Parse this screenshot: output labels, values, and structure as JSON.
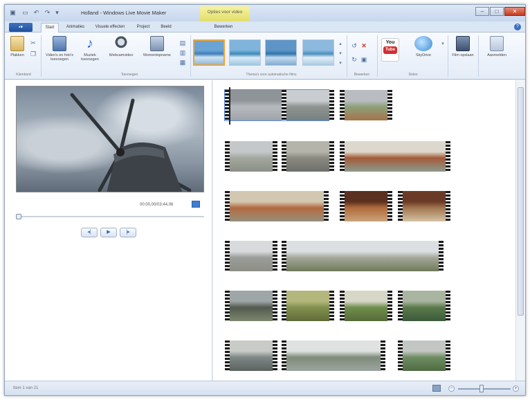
{
  "window": {
    "title": "Holland - Windows Live Movie Maker",
    "context_tab_title": "Opties voor video",
    "buttons": {
      "minimize": "–",
      "maximize": "□",
      "close": "✕"
    }
  },
  "qat": {
    "save_icon": "save-icon",
    "undo_icon": "undo-icon",
    "redo_icon": "redo-icon"
  },
  "app_menu": {
    "label": "▪▾"
  },
  "tabs": [
    {
      "label": "Start",
      "active": true
    },
    {
      "label": "Animaties"
    },
    {
      "label": "Visuele effecten"
    },
    {
      "label": "Project"
    },
    {
      "label": "Beeld"
    },
    {
      "label": "Bewerken"
    }
  ],
  "ribbon": {
    "clipboard": {
      "paste_label": "Plakken",
      "group": "Klembord"
    },
    "add": {
      "add_video_label": "Video's en foto's toevoegen",
      "add_music_label": "Muziek toevoegen",
      "snapshot_label": "Webcamvideo",
      "caption_label": "Momentopname",
      "group": "Toevoegen"
    },
    "themes": {
      "group": "Thema's voor automatische films"
    },
    "editing": {
      "group": "Bewerken"
    },
    "share": {
      "youtube_label": "You Tube",
      "skydrive_label": "SkyDrive",
      "group": "Delen"
    },
    "save_movie_label": "Film opslaan",
    "signin_label": "Aanmelden"
  },
  "preview": {
    "timecode": "00:00,00/03:44,06"
  },
  "transport": {
    "prev": "◂|",
    "play": "▶",
    "next": "|▸"
  },
  "status": {
    "text": "Item 1 van 21"
  },
  "zoom": {
    "minus": "−",
    "plus": "+",
    "level": 0.45
  }
}
